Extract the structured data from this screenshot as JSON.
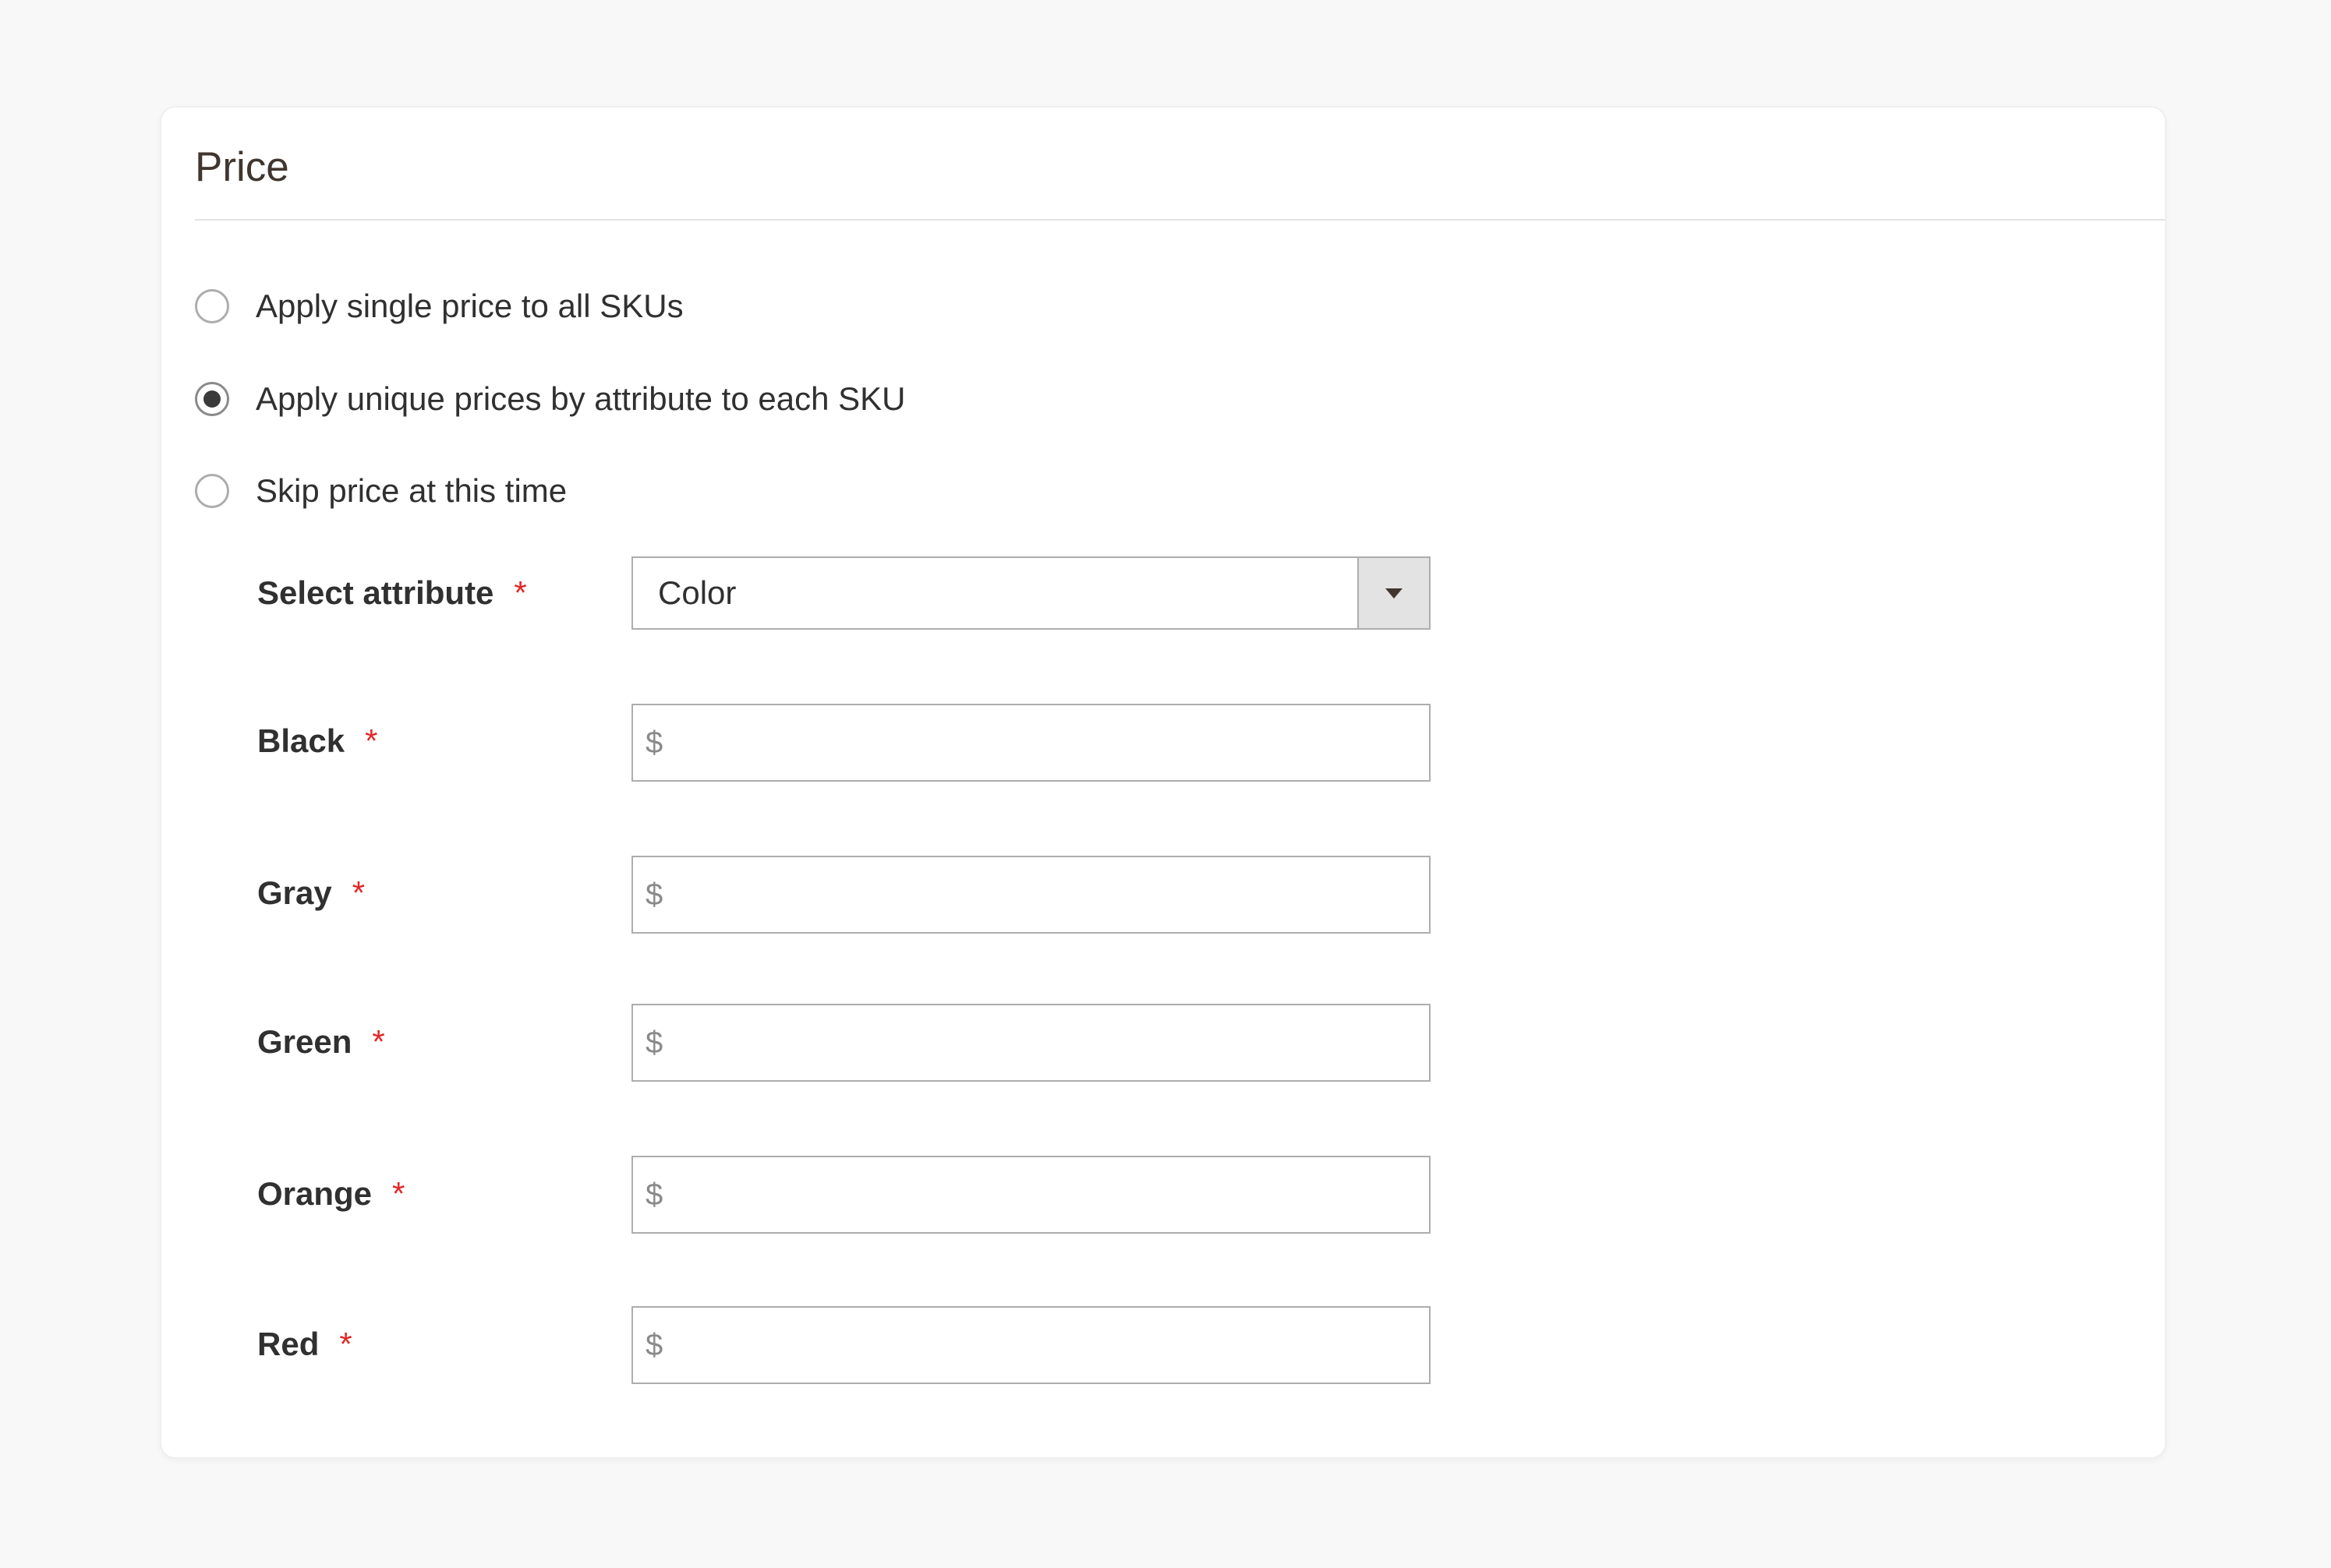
{
  "section": {
    "title": "Price"
  },
  "price_options": [
    {
      "label": "Apply single price to all SKUs",
      "checked": false
    },
    {
      "label": "Apply unique prices by attribute to each SKU",
      "checked": true
    },
    {
      "label": "Skip price at this time",
      "checked": false
    }
  ],
  "attribute": {
    "label": "Select attribute",
    "required_marker": "*",
    "selected_value": "Color"
  },
  "price_fields": [
    {
      "label": "Black",
      "required_marker": "*",
      "currency": "$",
      "value": ""
    },
    {
      "label": "Gray",
      "required_marker": "*",
      "currency": "$",
      "value": ""
    },
    {
      "label": "Green",
      "required_marker": "*",
      "currency": "$",
      "value": ""
    },
    {
      "label": "Orange",
      "required_marker": "*",
      "currency": "$",
      "value": ""
    },
    {
      "label": "Red",
      "required_marker": "*",
      "currency": "$",
      "value": ""
    }
  ],
  "colors": {
    "required": "#e22626",
    "input_border": "#adadad",
    "select_arrow_bg": "#e3e3e3"
  },
  "icons": {
    "select_arrow": "chevron-down-icon"
  }
}
